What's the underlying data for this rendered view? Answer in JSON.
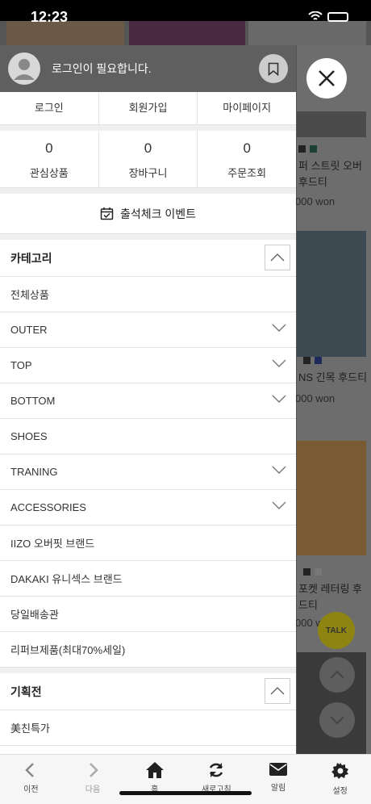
{
  "status_bar": {
    "time": "12:23"
  },
  "drawer": {
    "login_message": "로그인이 필요합니다.",
    "auth_links": [
      "로그인",
      "회원가입",
      "마이페이지"
    ],
    "counters": [
      {
        "value": "0",
        "label": "관심상품"
      },
      {
        "value": "0",
        "label": "장바구니"
      },
      {
        "value": "0",
        "label": "주문조회"
      }
    ],
    "event_label": "출석체크 이벤트",
    "category_title": "카테고리",
    "categories": [
      {
        "label": "전체상품",
        "expandable": false
      },
      {
        "label": "OUTER",
        "expandable": true
      },
      {
        "label": "TOP",
        "expandable": true
      },
      {
        "label": "BOTTOM",
        "expandable": true
      },
      {
        "label": "SHOES",
        "expandable": false
      },
      {
        "label": "TRANING",
        "expandable": true
      },
      {
        "label": "ACCESSORIES",
        "expandable": true
      },
      {
        "label": "IIZO 오버핏 브랜드",
        "expandable": false
      },
      {
        "label": "DAKAKI 유니섹스 브랜드",
        "expandable": false
      },
      {
        "label": "당일배송관",
        "expandable": false
      },
      {
        "label": "리퍼브제품(최대70%세일)",
        "expandable": false
      }
    ],
    "special_title": "기획전",
    "special_items": [
      "美친특가"
    ]
  },
  "background": {
    "product_texts": [
      "퍼 스트릿 오버",
      "후드티",
      "NS 긴목 후드티",
      "포켓 레터링 후",
      "드티"
    ],
    "prices": [
      "000 won",
      "000 won",
      "000 w"
    ],
    "talk_label": "TALK"
  },
  "bottom_nav": [
    {
      "label": "이전",
      "icon": "back-chevron-icon"
    },
    {
      "label": "다음",
      "icon": "forward-chevron-icon"
    },
    {
      "label": "홈",
      "icon": "home-icon"
    },
    {
      "label": "새로고침",
      "icon": "refresh-icon"
    },
    {
      "label": "알림",
      "icon": "mail-icon"
    },
    {
      "label": "설정",
      "icon": "gear-icon"
    }
  ],
  "colors": {
    "drawer_header": "#5f5f5f",
    "overlay": "#7a7a7a",
    "talk_yellow": "#8d8412"
  }
}
